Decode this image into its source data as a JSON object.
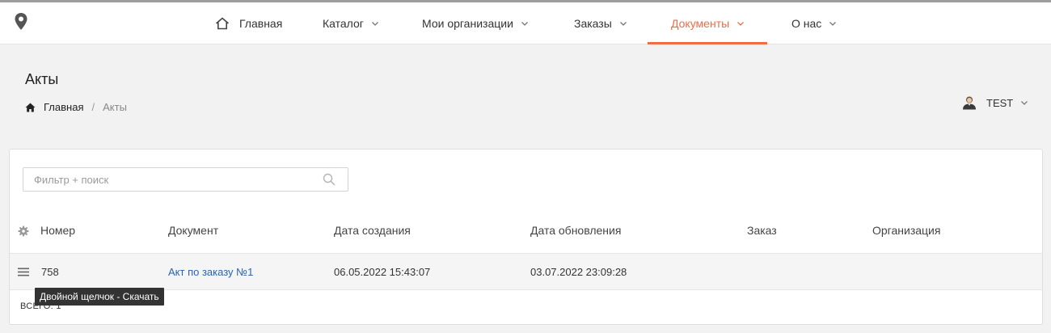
{
  "nav": {
    "items": [
      {
        "label": "Главная",
        "active": false
      },
      {
        "label": "Каталог",
        "active": false
      },
      {
        "label": "Мои организации",
        "active": false
      },
      {
        "label": "Заказы",
        "active": false
      },
      {
        "label": "Документы",
        "active": true
      },
      {
        "label": "О нас",
        "active": false
      }
    ],
    "accent_color": "#ef6c45"
  },
  "page": {
    "title": "Акты",
    "breadcrumb": {
      "home": "Главная",
      "separator": "/",
      "current": "Акты"
    }
  },
  "user": {
    "name": "TEST"
  },
  "search": {
    "placeholder": "Фильтр + поиск",
    "value": ""
  },
  "table": {
    "columns": [
      "Номер",
      "Документ",
      "Дата создания",
      "Дата обновления",
      "Заказ",
      "Организация"
    ],
    "rows": [
      {
        "number": "758",
        "document": "Акт по заказу №1",
        "created": "06.05.2022 15:43:07",
        "updated": "03.07.2022 23:09:28",
        "order": "",
        "organization": ""
      }
    ],
    "total": "ВСЕГО: 1"
  },
  "tooltip": {
    "text": "Двойной щелчок - Скачать"
  },
  "icons": {
    "logo": "location-pin-icon",
    "home": "home-icon",
    "chevron": "chevron-down-icon",
    "user": "user-icon",
    "search": "search-icon",
    "settings": "gear-icon",
    "row_menu": "menu-icon"
  }
}
